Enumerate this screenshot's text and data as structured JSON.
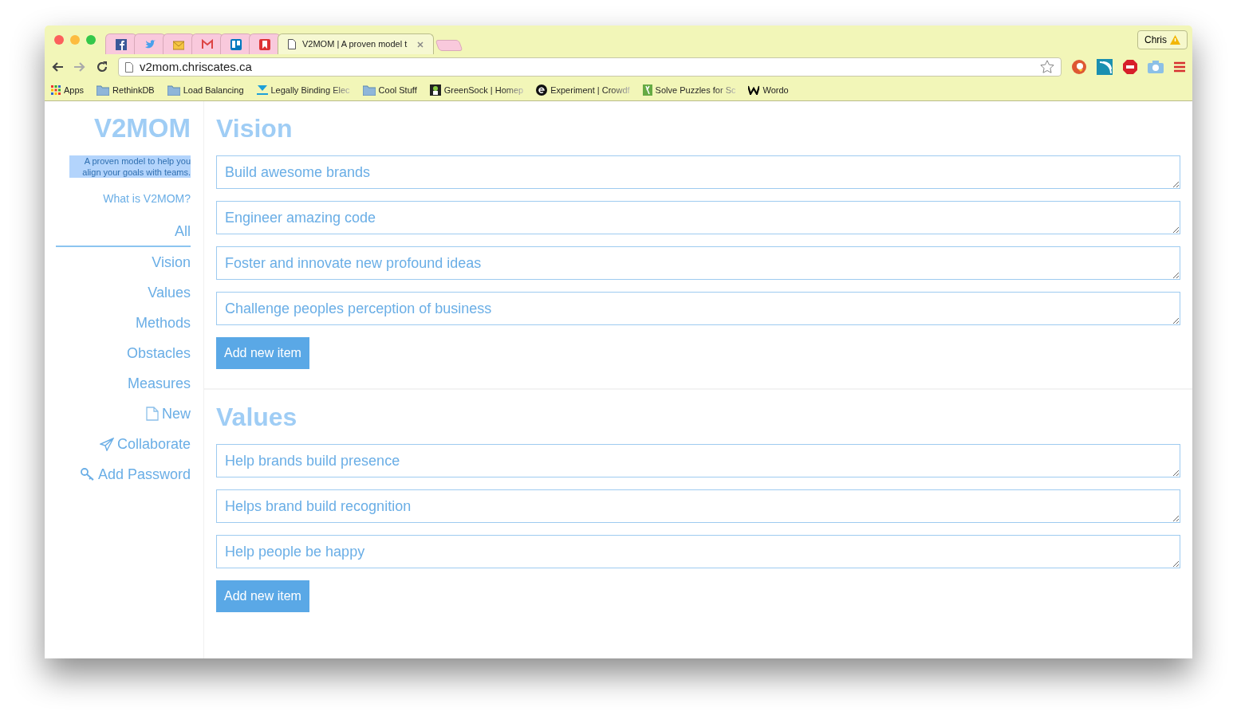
{
  "browser": {
    "tabs": [
      {
        "selected": false
      },
      {
        "selected": false
      },
      {
        "selected": false
      },
      {
        "selected": false
      },
      {
        "selected": false
      },
      {
        "selected": false
      },
      {
        "title": "V2MOM | A proven model t",
        "selected": true
      }
    ],
    "profile": "Chris",
    "address": "v2mom.chriscates.ca",
    "bookmarks": [
      "Apps",
      "RethinkDB",
      "Load Balancing",
      "Legally Binding Elec",
      "Cool Stuff",
      "GreenSock | Homep",
      "Experiment | Crowdf",
      "Solve Puzzles for Sc",
      "Wordo"
    ]
  },
  "sidebar": {
    "title": "V2MOM",
    "tagline": "A proven model to help you align your goals with teams.",
    "tagline_highlighted": true,
    "about_link": "What is V2MOM?",
    "nav": [
      {
        "label": "All",
        "selected": true
      },
      {
        "label": "Vision",
        "selected": false
      },
      {
        "label": "Values",
        "selected": false
      },
      {
        "label": "Methods",
        "selected": false
      },
      {
        "label": "Obstacles",
        "selected": false
      },
      {
        "label": "Measures",
        "selected": false
      }
    ],
    "actions": [
      "New",
      "Collaborate",
      "Add Password"
    ]
  },
  "sections": [
    {
      "heading": "Vision",
      "items": [
        "Build awesome brands",
        "Engineer amazing code",
        "Foster and innovate new profound ideas",
        "Challenge peoples perception of business"
      ],
      "button": "Add new item"
    },
    {
      "heading": "Values",
      "items": [
        "Help brands build presence",
        "Helps brand build recognition",
        "Help people be happy"
      ],
      "button": "Add new item"
    }
  ]
}
